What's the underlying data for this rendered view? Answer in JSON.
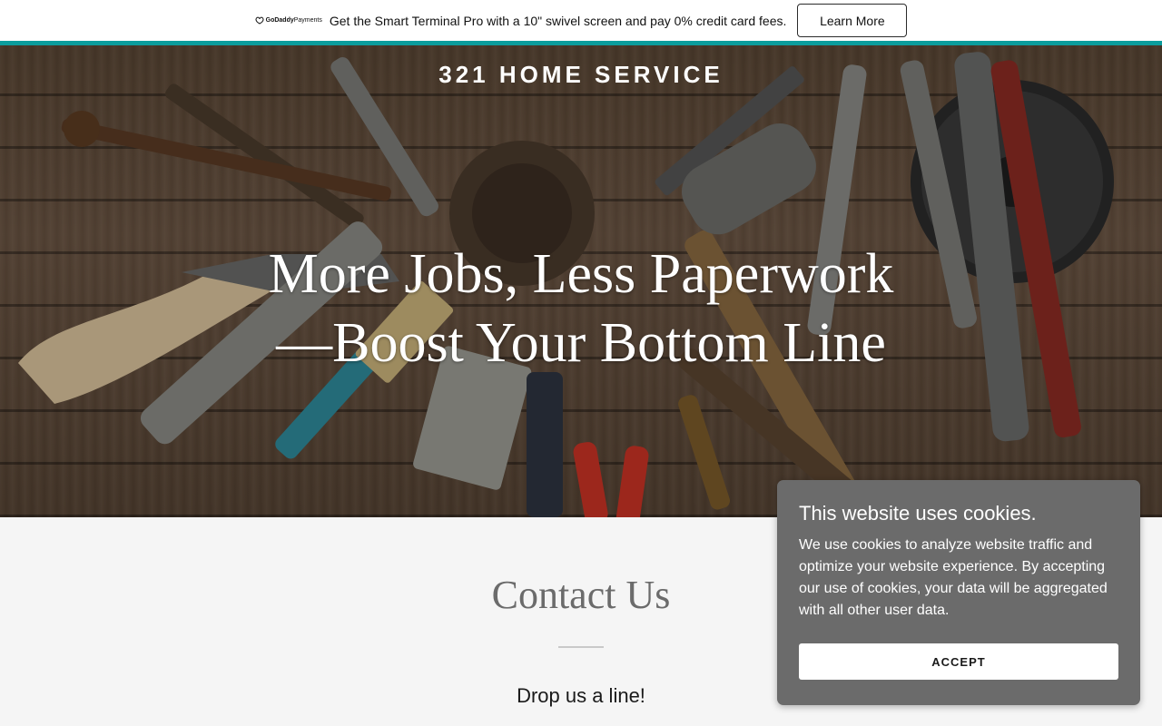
{
  "promo": {
    "logo_brand": "GoDaddy",
    "logo_product": "Payments",
    "text": "Get the Smart Terminal Pro with a 10\" swivel screen and pay 0% credit card fees.",
    "button_label": "Learn More",
    "accent_color": "#0b9d9d"
  },
  "hero": {
    "brand": "321 HOME SERVICE",
    "headline_line1": "More Jobs, Less Paperwork",
    "headline_line2": "—Boost Your Bottom Line"
  },
  "contact": {
    "title": "Contact Us",
    "subtitle": "Drop us a line!"
  },
  "cookie_banner": {
    "title": "This website uses cookies.",
    "body": "We use cookies to analyze website traffic and optimize your website experience. By accepting our use of cookies, your data will be aggregated with all other user data.",
    "accept_label": "ACCEPT"
  }
}
